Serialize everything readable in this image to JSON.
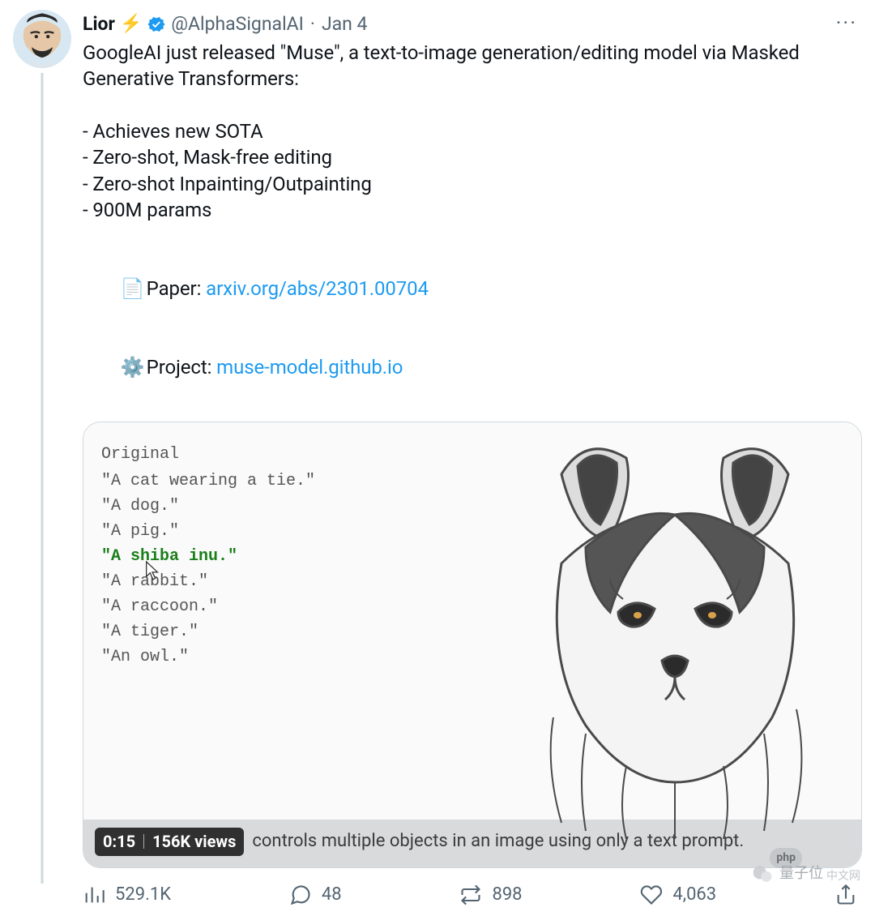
{
  "header": {
    "display_name": "Lior",
    "bolt": "⚡",
    "handle": "@AlphaSignalAI",
    "dot": "·",
    "date": "Jan 4",
    "more": "···"
  },
  "body": {
    "para1": "GoogleAI just released \"Muse\", a text-to-image generation/editing model via Masked Generative Transformers:",
    "bullets": [
      "- Achieves new SOTA",
      "- Zero-shot, Mask-free editing",
      "- Zero-shot Inpainting/Outpainting",
      "- 900M params"
    ],
    "paper_emoji": "📄",
    "paper_label": " Paper: ",
    "paper_link": "arxiv.org/abs/2301.00704",
    "project_emoji": "⚙️",
    "project_label": " Project: ",
    "project_link": "muse-model.github.io"
  },
  "media": {
    "list_head": "Original",
    "prompts": [
      "\"A cat wearing a tie.\"",
      "\"A dog.\"",
      "\"A pig.\"",
      "\"A shiba inu.\"",
      "\"A rabbit.\"",
      "\"A raccoon.\"",
      "\"A tiger.\"",
      "\"An owl.\""
    ],
    "selected_index": 3,
    "pill_time": "0:15",
    "pill_views": "156K views",
    "caption": "controls multiple objects in an image using only a text prompt."
  },
  "actions": {
    "views": "529.1K",
    "replies": "48",
    "retweets": "898",
    "likes": "4,063"
  },
  "watermark": {
    "php": "php",
    "text": "量子位",
    "cn": "中文网"
  }
}
